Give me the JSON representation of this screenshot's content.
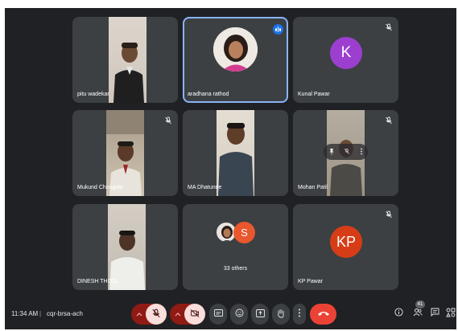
{
  "participants": {
    "pitu": {
      "name": "pitu wadekar"
    },
    "aradhana": {
      "name": "aradhana rathod"
    },
    "kunal": {
      "name": "Kunal Pawar",
      "initial": "K",
      "avatar_color": "#9c3fd0"
    },
    "mukund": {
      "name": "Mukund Chougale"
    },
    "dhatunde": {
      "name": "MA Dhatunde"
    },
    "mohan": {
      "name": "Mohan Patil"
    },
    "dinesh": {
      "name": "DINESH THOOL"
    },
    "others": {
      "label": "33 others",
      "avatar_initial": "S",
      "avatar_color": "#e8572e"
    },
    "kp": {
      "name": "KP Pawar",
      "initials": "KP",
      "avatar_color": "#d63d16"
    }
  },
  "meeting": {
    "time": "11:34 AM",
    "separator": "|",
    "code": "cqr-brsa-ach"
  },
  "people_count": "41",
  "colors": {
    "background": "#202124",
    "tile": "#3c4043",
    "speaking_outline": "#8ab4f8",
    "end_call": "#ea4335",
    "muted_red": "#8f1b14"
  },
  "icons": {
    "muted": "mic-off-icon",
    "speaking": "audio-level-icon",
    "controls": [
      "chevron-up-icon",
      "mic-off-icon",
      "chevron-up-icon",
      "camera-off-icon",
      "captions-icon",
      "emoji-icon",
      "present-screen-icon",
      "raise-hand-icon",
      "more-options-icon",
      "end-call-icon"
    ],
    "right": [
      "info-icon",
      "people-icon",
      "chat-icon",
      "activities-icon"
    ]
  }
}
